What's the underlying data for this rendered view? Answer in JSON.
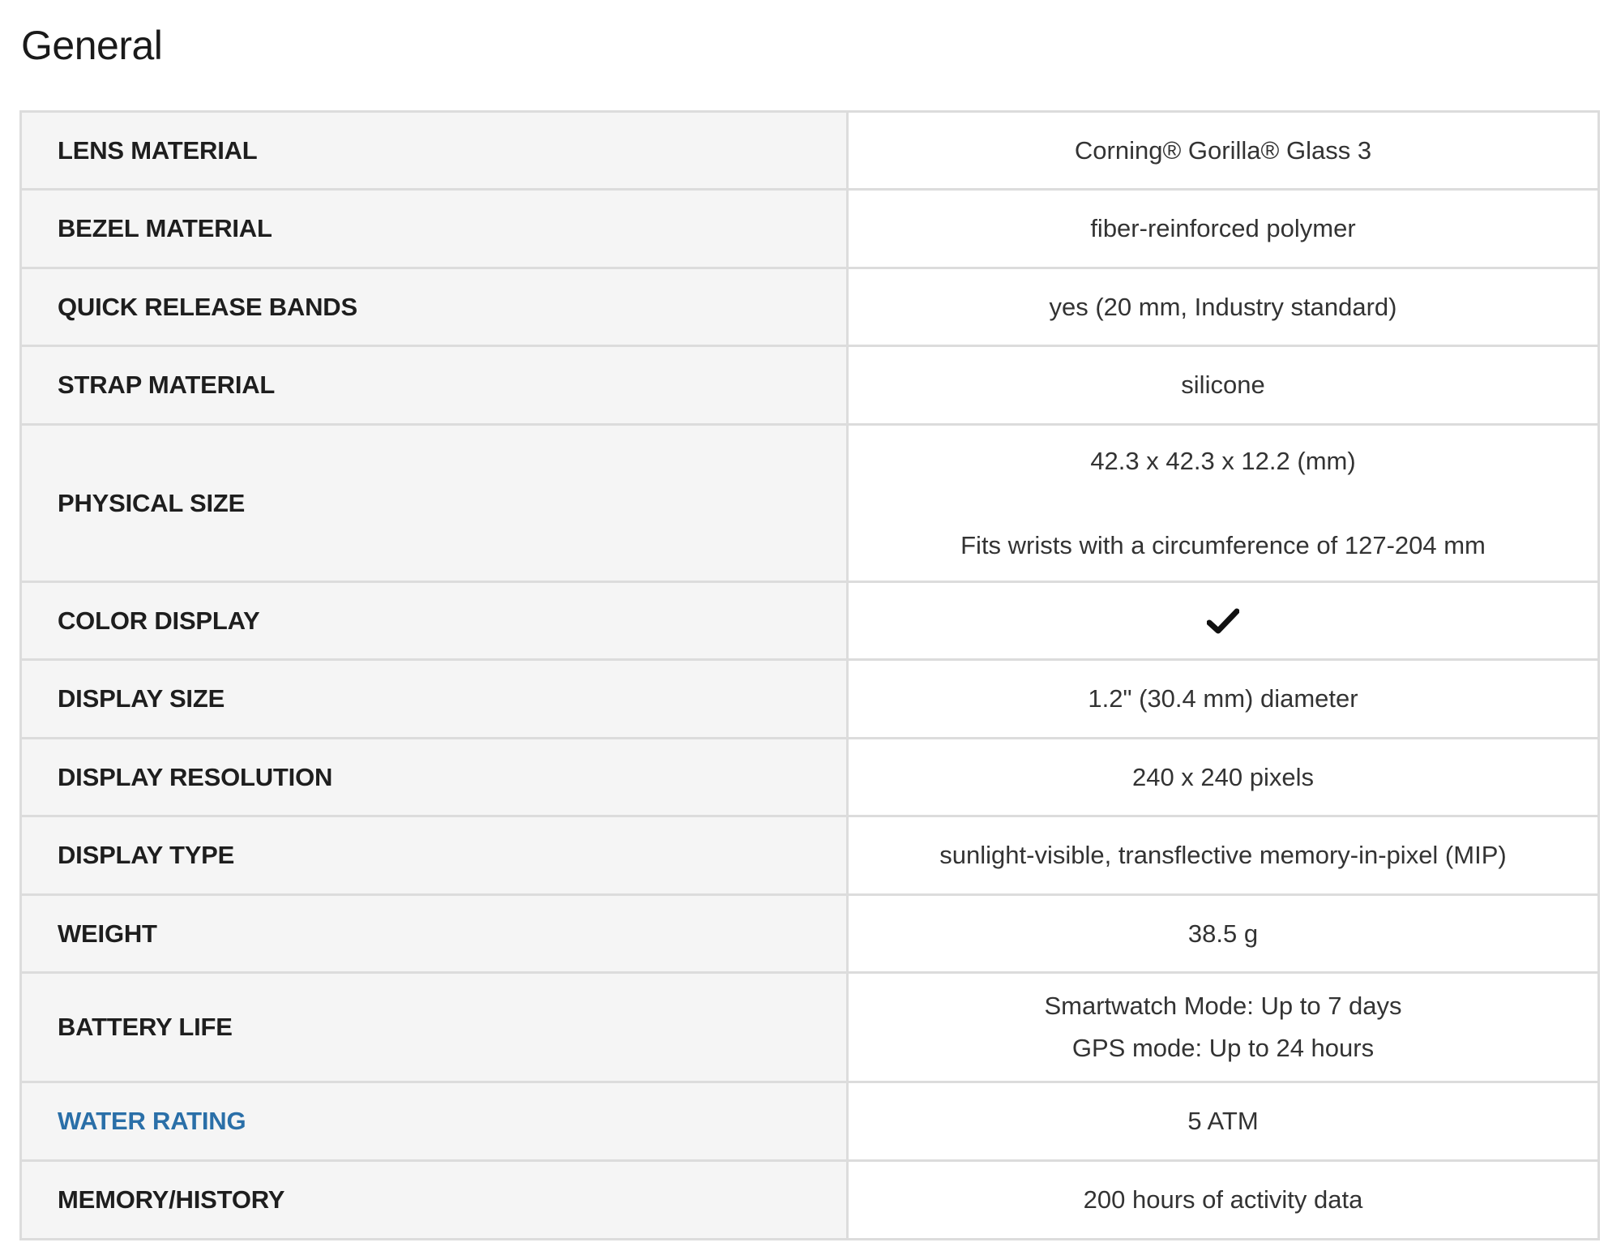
{
  "section": {
    "title": "General"
  },
  "specs": {
    "lens_material": {
      "label": "LENS MATERIAL",
      "value": "Corning® Gorilla® Glass 3"
    },
    "bezel_material": {
      "label": "BEZEL MATERIAL",
      "value": "fiber-reinforced polymer"
    },
    "quick_release_bands": {
      "label": "QUICK RELEASE BANDS",
      "value": "yes (20 mm, Industry standard)"
    },
    "strap_material": {
      "label": "STRAP MATERIAL",
      "value": "silicone"
    },
    "physical_size": {
      "label": "PHYSICAL SIZE",
      "value_line1": "42.3 x 42.3 x 12.2 (mm)",
      "value_line2": "Fits wrists with a circumference of 127-204 mm"
    },
    "color_display": {
      "label": "COLOR DISPLAY",
      "value_icon": "checkmark-icon"
    },
    "display_size": {
      "label": "DISPLAY SIZE",
      "value": "1.2\" (30.4 mm) diameter"
    },
    "display_resolution": {
      "label": "DISPLAY RESOLUTION",
      "value": "240 x 240 pixels"
    },
    "display_type": {
      "label": "DISPLAY TYPE",
      "value": "sunlight-visible, transflective memory-in-pixel (MIP)"
    },
    "weight": {
      "label": "WEIGHT",
      "value": "38.5 g"
    },
    "battery_life": {
      "label": "BATTERY LIFE",
      "value_line1": "Smartwatch Mode: Up to 7 days",
      "value_line2": "GPS mode: Up to 24 hours"
    },
    "water_rating": {
      "label": "WATER RATING",
      "value": "5 ATM",
      "label_color": "#2a6fa8"
    },
    "memory_history": {
      "label": "MEMORY/HISTORY",
      "value": "200 hours of activity data"
    }
  },
  "colors": {
    "label_background": "#f5f5f5",
    "border": "#dcdcdc",
    "link": "#2a6fa8"
  }
}
